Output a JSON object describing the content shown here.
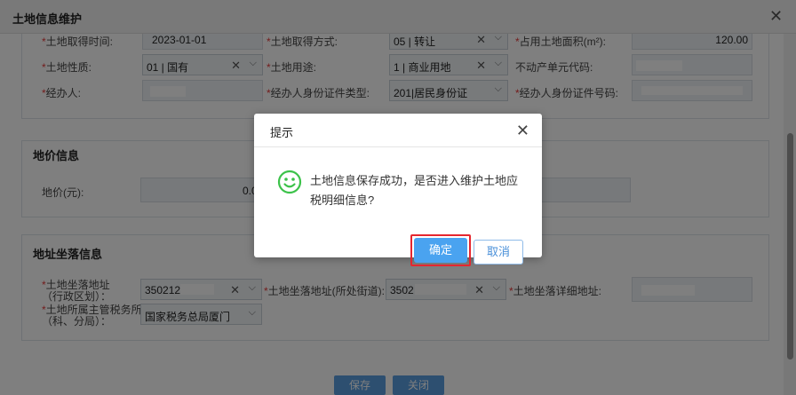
{
  "window": {
    "title": "土地信息维护"
  },
  "land_info": {
    "acquire_time_label": "*土地取得时间:",
    "acquire_time_value": "2023-01-01",
    "acquire_method_label": "*土地取得方式:",
    "acquire_method_value": "05 | 转让",
    "area_label": "*占用土地面积(m²):",
    "area_value": "120.00",
    "nature_label": "*土地性质:",
    "nature_value": "01 | 国有",
    "usage_label": "*土地用途:",
    "usage_value": "1 | 商业用地",
    "property_unit_label": "不动产单元代码:",
    "operator_label": "*经办人:",
    "id_type_label": "*经办人身份证件类型:",
    "id_type_value": "201|居民身份证",
    "id_number_label": "*经办人身份证件号码:"
  },
  "price_info": {
    "section_title": "地价信息",
    "price_label": "地价(元):",
    "price_value": "0.0"
  },
  "address_info": {
    "section_title": "地址坐落信息",
    "location_label_line1": "*土地坐落地址",
    "location_label_line2": "（行政区划）：",
    "location_value": "350212",
    "street_label": "*土地坐落地址(所处街道):",
    "street_value": "3502",
    "detail_label": "*土地坐落详细地址:",
    "tax_office_label_line1": "*土地所属主管税务所",
    "tax_office_label_line2": "（科、分局）：",
    "tax_office_value": "国家税务总局厦门"
  },
  "footer": {
    "save_label": "保存",
    "close_label": "关闭"
  },
  "dialog": {
    "title": "提示",
    "message": "土地信息保存成功，是否进入维护土地应税明细信息?",
    "ok_label": "确定",
    "cancel_label": "取消"
  },
  "colors": {
    "accent": "#4aa3f0",
    "highlight": "#e5262f",
    "smile": "#3cc24a",
    "required": "#e63a3a"
  },
  "icons": [
    "close-icon",
    "smile-icon",
    "chevron-down-icon",
    "clear-icon"
  ]
}
